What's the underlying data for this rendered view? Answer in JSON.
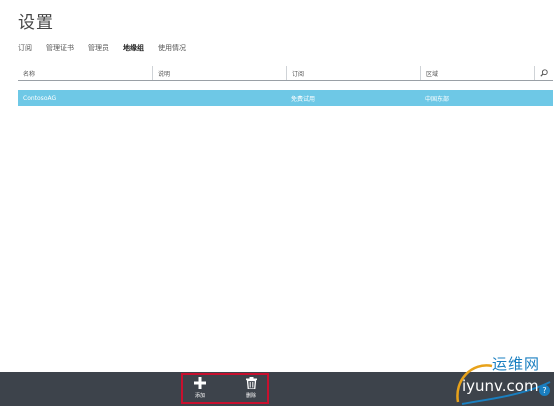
{
  "page": {
    "title": "设置"
  },
  "tabs": [
    {
      "label": "订阅"
    },
    {
      "label": "管理证书"
    },
    {
      "label": "管理员"
    },
    {
      "label": "地缘组"
    },
    {
      "label": "使用情况"
    }
  ],
  "active_tab": "地缘组",
  "table": {
    "columns": [
      "名称",
      "说明",
      "订阅",
      "区域"
    ],
    "rows": [
      {
        "name": "ContosoAG",
        "description": "",
        "subscription": "免费试用",
        "region": "中国东部"
      }
    ]
  },
  "commands": {
    "add_label": "添加",
    "delete_label": "删除"
  },
  "watermark": {
    "line1": "运维网",
    "line2": "iyunv.com"
  },
  "colors": {
    "accent": "#6ec8e6",
    "bottom_bar": "#3d434b",
    "highlight_border": "#c8102e",
    "watermark_blue": "#1a7fc0"
  },
  "icons": [
    "search-icon",
    "plus-icon",
    "trash-icon",
    "help-icon"
  ]
}
